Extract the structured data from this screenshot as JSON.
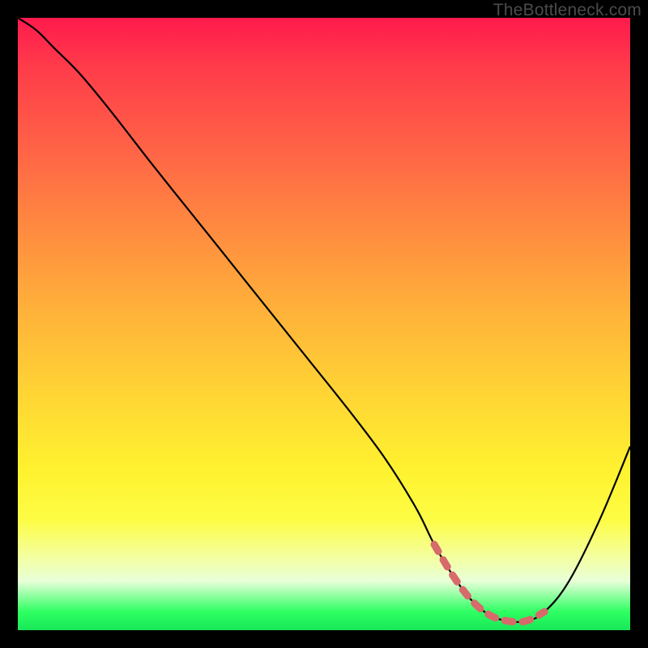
{
  "watermark": "TheBottleneck.com",
  "chart_data": {
    "type": "line",
    "title": "",
    "xlabel": "",
    "ylabel": "",
    "xlim": [
      0,
      100
    ],
    "ylim": [
      0,
      100
    ],
    "series": [
      {
        "name": "curve",
        "x": [
          0,
          3,
          6,
          10,
          15,
          22,
          30,
          38,
          46,
          54,
          60,
          65,
          68,
          71,
          74,
          77,
          80,
          83,
          86,
          90,
          95,
          100
        ],
        "y": [
          100,
          98,
          95,
          91,
          85,
          76,
          66,
          56,
          46,
          36,
          28,
          20,
          14,
          9,
          5,
          2.5,
          1.5,
          1.5,
          3,
          8,
          18,
          30
        ]
      },
      {
        "name": "highlight-band",
        "x": [
          68,
          86
        ],
        "y": [
          1.8,
          1.8
        ]
      }
    ],
    "annotations": []
  }
}
